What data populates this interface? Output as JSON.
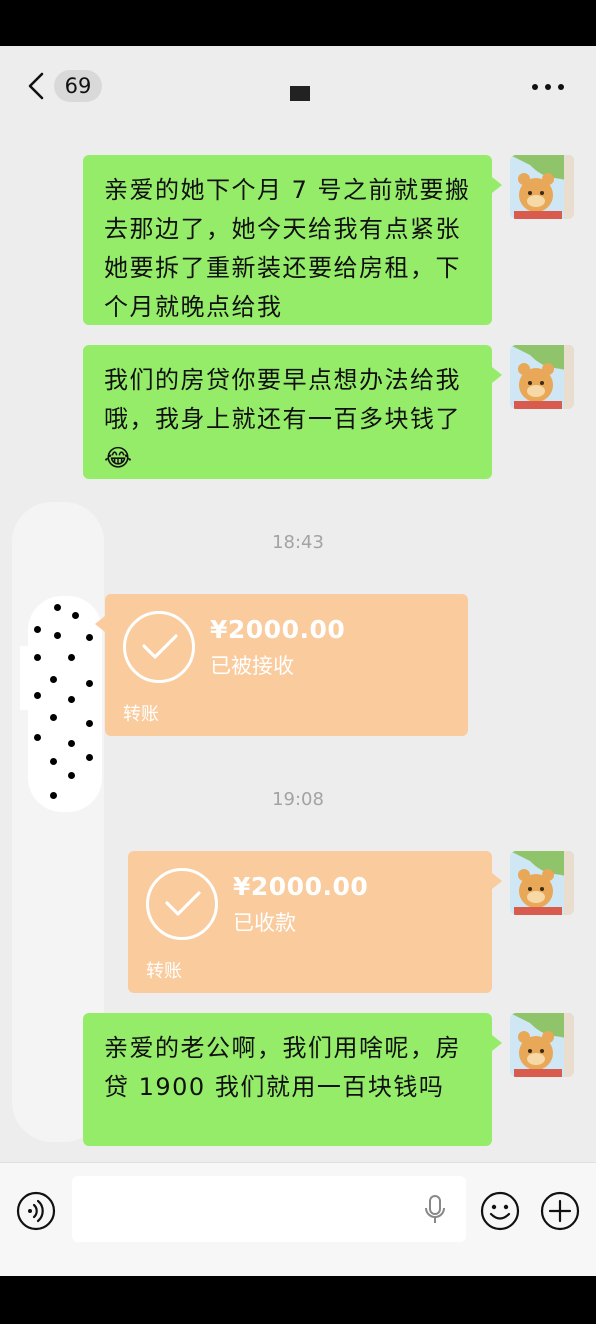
{
  "header": {
    "back_icon": "chevron-left-icon",
    "unread_count": "69",
    "more_icon": "more-dots-icon"
  },
  "messages": [
    {
      "type": "text",
      "side": "right",
      "text": "亲爱的她下个月 7 号之前就要搬去那边了，她今天给我有点紧张她要拆了重新装还要给房租，下个月就晚点给我"
    },
    {
      "type": "text",
      "side": "right",
      "text": "我们的房贷你要早点想办法给我哦，我身上就还有一百多块钱了😂"
    },
    {
      "type": "time",
      "text": "18:43"
    },
    {
      "type": "transfer",
      "side": "left",
      "amount": "¥2000.00",
      "status": "已被接收",
      "label": "转账"
    },
    {
      "type": "time",
      "text": "19:08"
    },
    {
      "type": "transfer",
      "side": "right",
      "amount": "¥2000.00",
      "status": "已收款",
      "label": "转账"
    },
    {
      "type": "text",
      "side": "right",
      "text": "亲爱的老公啊，我们用啥呢，房贷 1900 我们就用一百块钱吗"
    }
  ],
  "input_bar": {
    "voice_icon": "voice-mode-icon",
    "input_value": "",
    "mic_icon": "microphone-icon",
    "emoji_icon": "emoji-icon",
    "plus_icon": "plus-circle-icon"
  },
  "colors": {
    "chat_bg": "#ededed",
    "bubble_green": "#95ec69",
    "transfer_orange": "#f9cb9d",
    "time_gray": "#a3a3a3"
  }
}
